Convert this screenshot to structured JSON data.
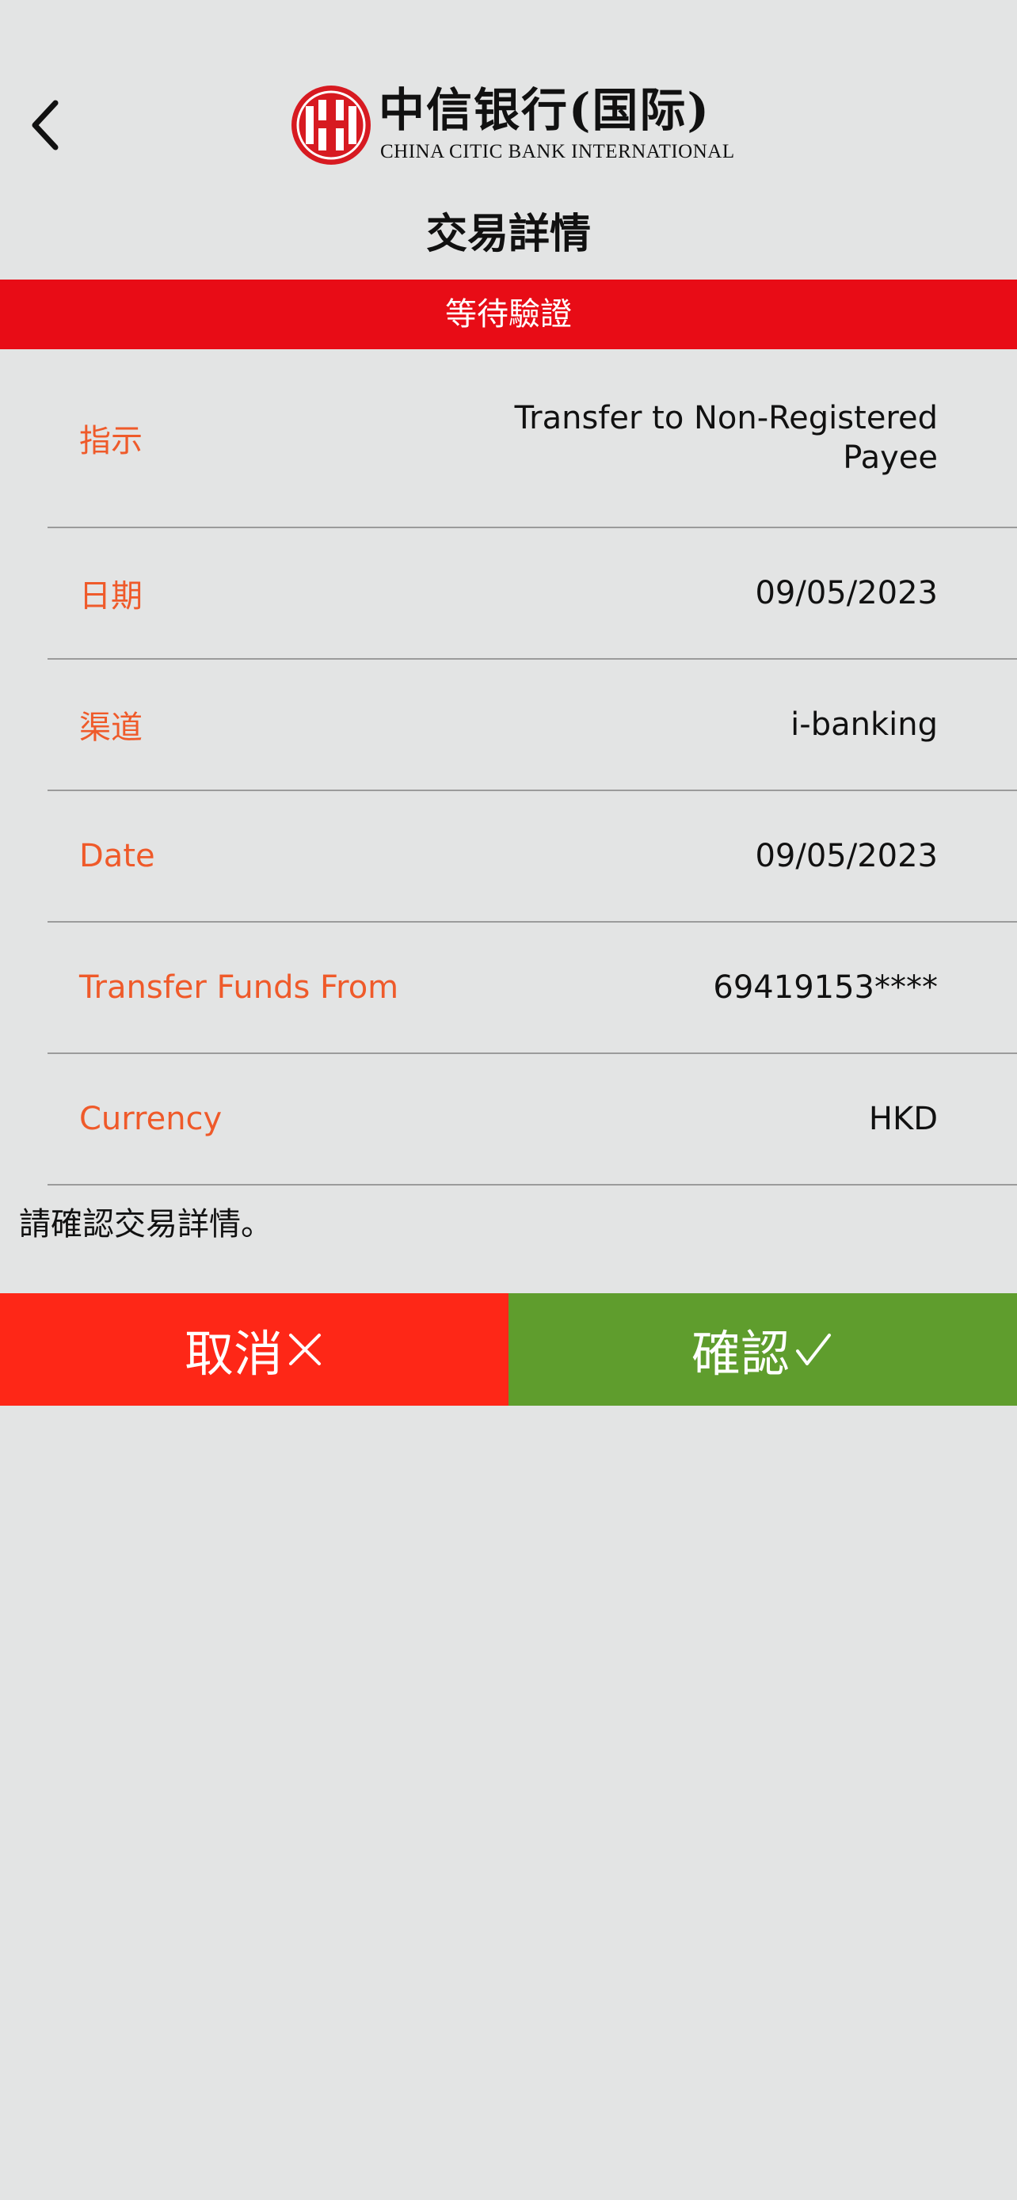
{
  "header": {
    "back_icon": "chevron-left-icon",
    "logo": {
      "name_cn": "中信银行(国际)",
      "name_en": "CHINA CITIC BANK INTERNATIONAL",
      "brand_color": "#d71a21"
    }
  },
  "page": {
    "title": "交易詳情",
    "status": "等待驗證",
    "status_color": "#e80c16"
  },
  "details": [
    {
      "label": "指示",
      "value": "Transfer to Non-Registered Payee"
    },
    {
      "label": "日期",
      "value": "09/05/2023"
    },
    {
      "label": "渠道",
      "value": "i-banking"
    },
    {
      "label": "Date",
      "value": "09/05/2023"
    },
    {
      "label": "Transfer Funds From",
      "value": "69419153****"
    },
    {
      "label": "Currency",
      "value": "HKD"
    }
  ],
  "confirm_prompt": "請確認交易詳情。",
  "actions": {
    "cancel_label": "取消",
    "cancel_icon": "close-icon",
    "cancel_color": "#fe2717",
    "confirm_label": "確認",
    "confirm_icon": "checkmark-icon",
    "confirm_color": "#5f9d2d"
  },
  "colors": {
    "background": "#e3e4e4",
    "label": "#ef5a2a",
    "divider": "#9b9b9b"
  }
}
